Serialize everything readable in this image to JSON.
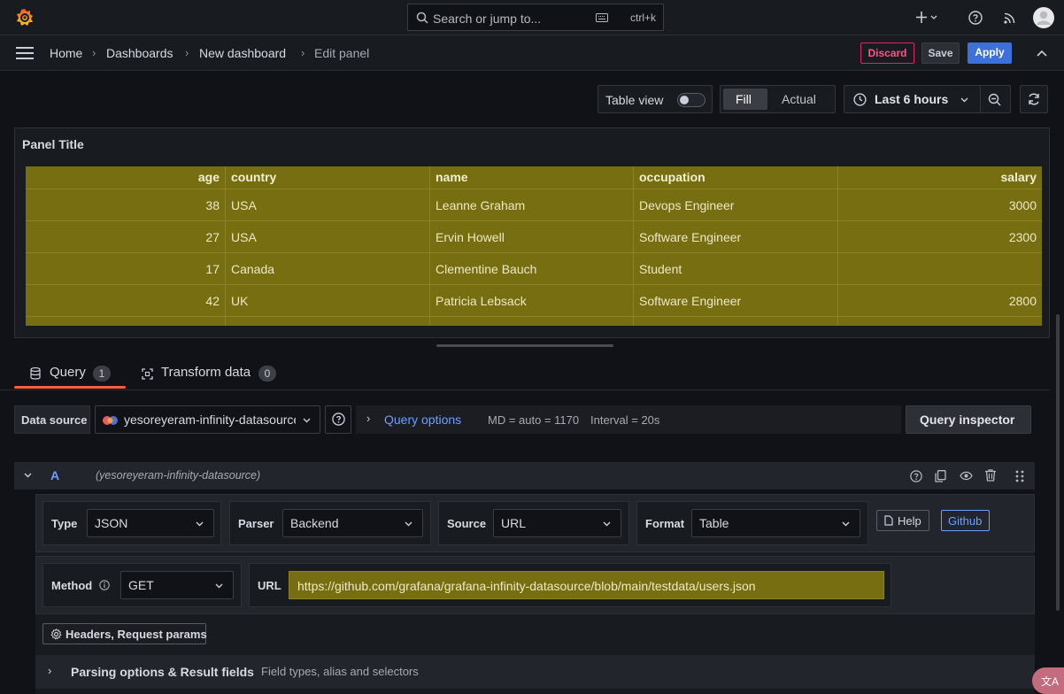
{
  "search": {
    "placeholder": "Search or jump to...",
    "shortcut": "ctrl+k"
  },
  "breadcrumbs": [
    "Home",
    "Dashboards",
    "New dashboard",
    "Edit panel"
  ],
  "actions": {
    "discard": "Discard",
    "save": "Save",
    "apply": "Apply"
  },
  "toolbar": {
    "table_view": "Table view",
    "fill": "Fill",
    "actual": "Actual",
    "time_range": "Last 6 hours"
  },
  "panel": {
    "title": "Panel Title",
    "columns": [
      "age",
      "country",
      "name",
      "occupation",
      "salary"
    ],
    "rows": [
      [
        "38",
        "USA",
        "Leanne Graham",
        "Devops Engineer",
        "3000"
      ],
      [
        "27",
        "USA",
        "Ervin Howell",
        "Software Engineer",
        "2300"
      ],
      [
        "17",
        "Canada",
        "Clementine Bauch",
        "Student",
        ""
      ],
      [
        "42",
        "UK",
        "Patricia Lebsack",
        "Software Engineer",
        "2800"
      ]
    ]
  },
  "tabs": [
    {
      "label": "Query",
      "count": "1"
    },
    {
      "label": "Transform data",
      "count": "0"
    }
  ],
  "query_bar": {
    "datasource_label": "Data source",
    "datasource_value": "yesoreyeram-infinity-datasource",
    "query_options": "Query options",
    "md": "MD = auto = 1170",
    "interval": "Interval = 20s",
    "inspector": "Query inspector"
  },
  "query_a": {
    "ref": "A",
    "source_name": "(yesoreyeram-infinity-datasource)",
    "type_label": "Type",
    "type_value": "JSON",
    "parser_label": "Parser",
    "parser_value": "Backend",
    "source_label": "Source",
    "source_value": "URL",
    "format_label": "Format",
    "format_value": "Table",
    "help": "Help",
    "github": "Github",
    "method_label": "Method",
    "method_value": "GET",
    "url_label": "URL",
    "url_value": "https://github.com/grafana/grafana-infinity-datasource/blob/main/testdata/users.json",
    "headers_btn": "Headers, Request params",
    "parsing_title": "Parsing options & Result fields",
    "parsing_desc": "Field types, alias and selectors"
  },
  "colors": {
    "accent": "#3d71d9",
    "discard": "#e0226e",
    "table_bg": "#776e12",
    "tab_underline": "#f55f3e"
  }
}
